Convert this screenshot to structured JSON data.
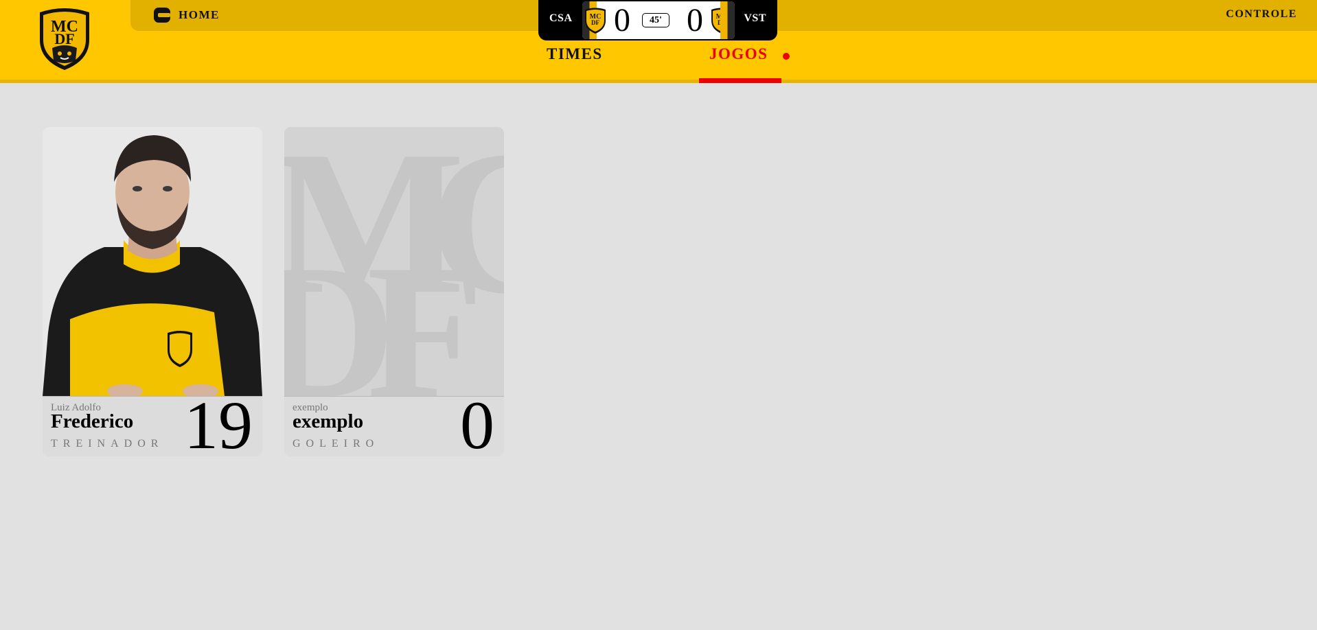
{
  "header": {
    "home_label": "HOME",
    "controle_label": "CONTROLE",
    "logo_text": "MCDF",
    "brand_yellow": "#ffc700",
    "accent_red": "#ee0000"
  },
  "scoreboard": {
    "home_team": "CSA",
    "away_team": "VST",
    "home_score": "0",
    "away_score": "0",
    "clock": "45'"
  },
  "nav": {
    "tabs": [
      {
        "label": "TIMES",
        "active": false
      },
      {
        "label": "JOGOS",
        "active": true
      }
    ]
  },
  "players": [
    {
      "first_name": "Luiz Adolfo",
      "last_name": "Frederico",
      "role": "TREINADOR",
      "number": "19",
      "has_photo": true
    },
    {
      "first_name": "exemplo",
      "last_name": "exemplo",
      "role": "GOLEIRO",
      "number": "0",
      "has_photo": false
    }
  ]
}
